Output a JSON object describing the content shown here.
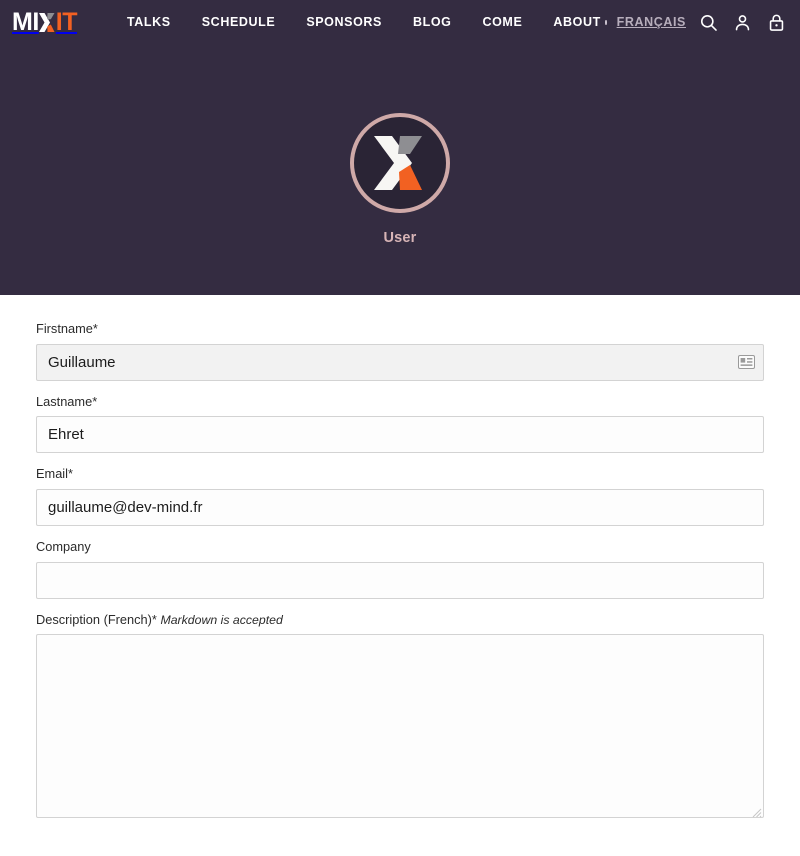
{
  "site": {
    "logo_mi": "MIX",
    "logo_it": "IT",
    "brand_orange": "#f26122",
    "header_bg": "#342c41"
  },
  "nav": {
    "links": [
      {
        "label": "TALKS",
        "name": "nav-link-talks"
      },
      {
        "label": "SCHEDULE",
        "name": "nav-link-schedule"
      },
      {
        "label": "SPONSORS",
        "name": "nav-link-sponsors"
      },
      {
        "label": "BLOG",
        "name": "nav-link-blog"
      },
      {
        "label": "COME",
        "name": "nav-link-come"
      },
      {
        "label": "ABOUT",
        "name": "nav-link-about"
      }
    ],
    "language": "FRANÇAIS",
    "icons": [
      "search-icon",
      "user-icon",
      "lock-icon"
    ]
  },
  "profile": {
    "avatar_alt": "mixit-logo-avatar",
    "name": "User",
    "ring_color": "#cfa9a8",
    "name_color": "#d7b4b6"
  },
  "form": {
    "fields": [
      {
        "label": "Firstname",
        "required": "*",
        "value": "Guillaume",
        "placeholder": "",
        "type": "text",
        "autofilled": true
      },
      {
        "label": "Lastname",
        "required": "*",
        "value": "Ehret",
        "placeholder": "",
        "type": "text",
        "autofilled": false
      },
      {
        "label": "Email",
        "required": "*",
        "value": "guillaume@dev-mind.fr",
        "placeholder": "",
        "type": "text",
        "autofilled": false
      },
      {
        "label": "Company",
        "required": "",
        "value": "",
        "placeholder": "",
        "type": "text",
        "autofilled": false
      },
      {
        "label": "Description (French)",
        "required": "*",
        "hint": "Markdown is accepted",
        "value": "",
        "placeholder": "",
        "type": "textarea",
        "autofilled": false
      }
    ]
  }
}
